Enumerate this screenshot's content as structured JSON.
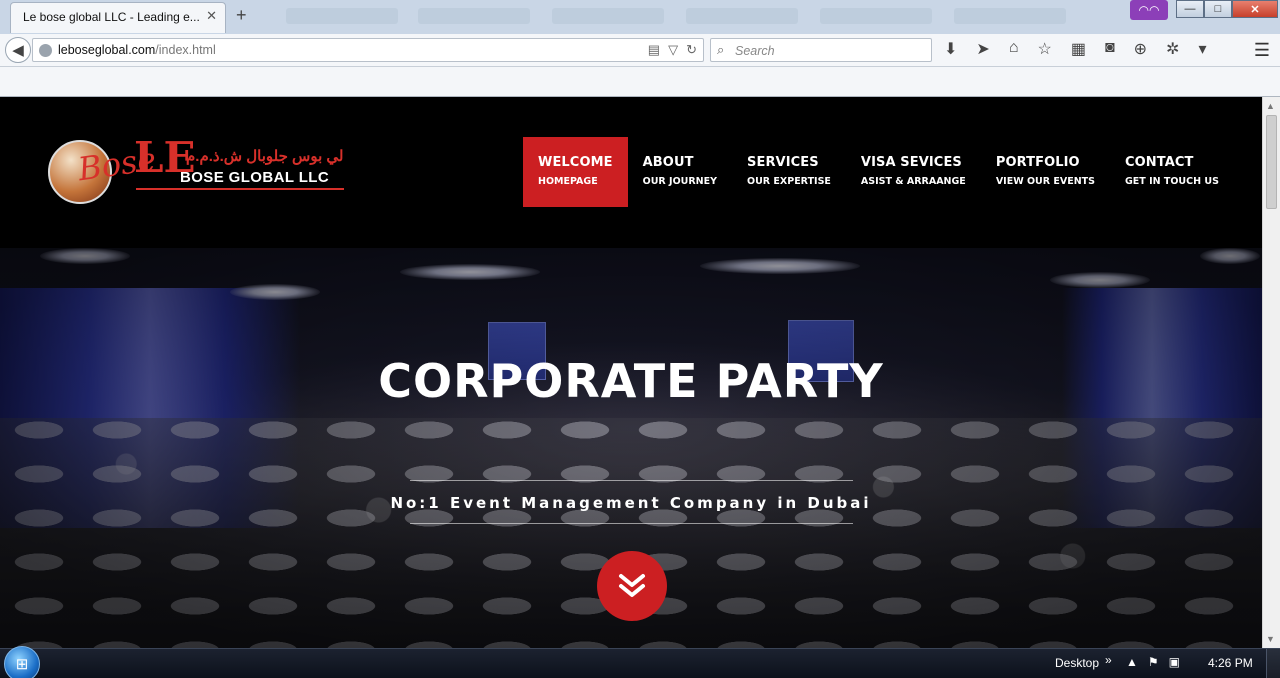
{
  "browser": {
    "tab_title": "Le bose global LLC - Leading e...",
    "tab_close": "✕",
    "new_tab": "+",
    "url_domain": "leboseglobal.com",
    "url_path": "/index.html",
    "search_placeholder": "Search",
    "private_icon": "mask-icon",
    "window_buttons": {
      "minimize": "—",
      "maximize": "□",
      "close": "✕"
    }
  },
  "site": {
    "logo": {
      "arabic": "لي بوس جلوبال ش.ذ.م.م",
      "english": "BOSE GLOBAL LLC",
      "script": "Bose",
      "mark": "LE"
    },
    "menu": [
      {
        "title": "WELCOME",
        "sub": "HOMEPAGE",
        "active": true
      },
      {
        "title": "ABOUT",
        "sub": "OUR JOURNEY",
        "active": false
      },
      {
        "title": "SERVICES",
        "sub": "OUR EXPERTISE",
        "active": false
      },
      {
        "title": "VISA SEVICES",
        "sub": "ASIST & ARRAANGE",
        "active": false
      },
      {
        "title": "PORTFOLIO",
        "sub": "VIEW OUR EVENTS",
        "active": false
      },
      {
        "title": "CONTACT",
        "sub": "GET IN TOUCH US",
        "active": false
      }
    ],
    "hero": {
      "title": "CORPORATE PARTY",
      "subtitle": "No:1 Event Management Company in Dubai",
      "scroll_icon": "double-chevron-down-icon"
    },
    "colors": {
      "accent": "#cc1f22",
      "header_bg": "#000000"
    }
  },
  "taskbar": {
    "desktop_label": "Desktop",
    "chevron": "»",
    "time": "4:26 PM"
  }
}
